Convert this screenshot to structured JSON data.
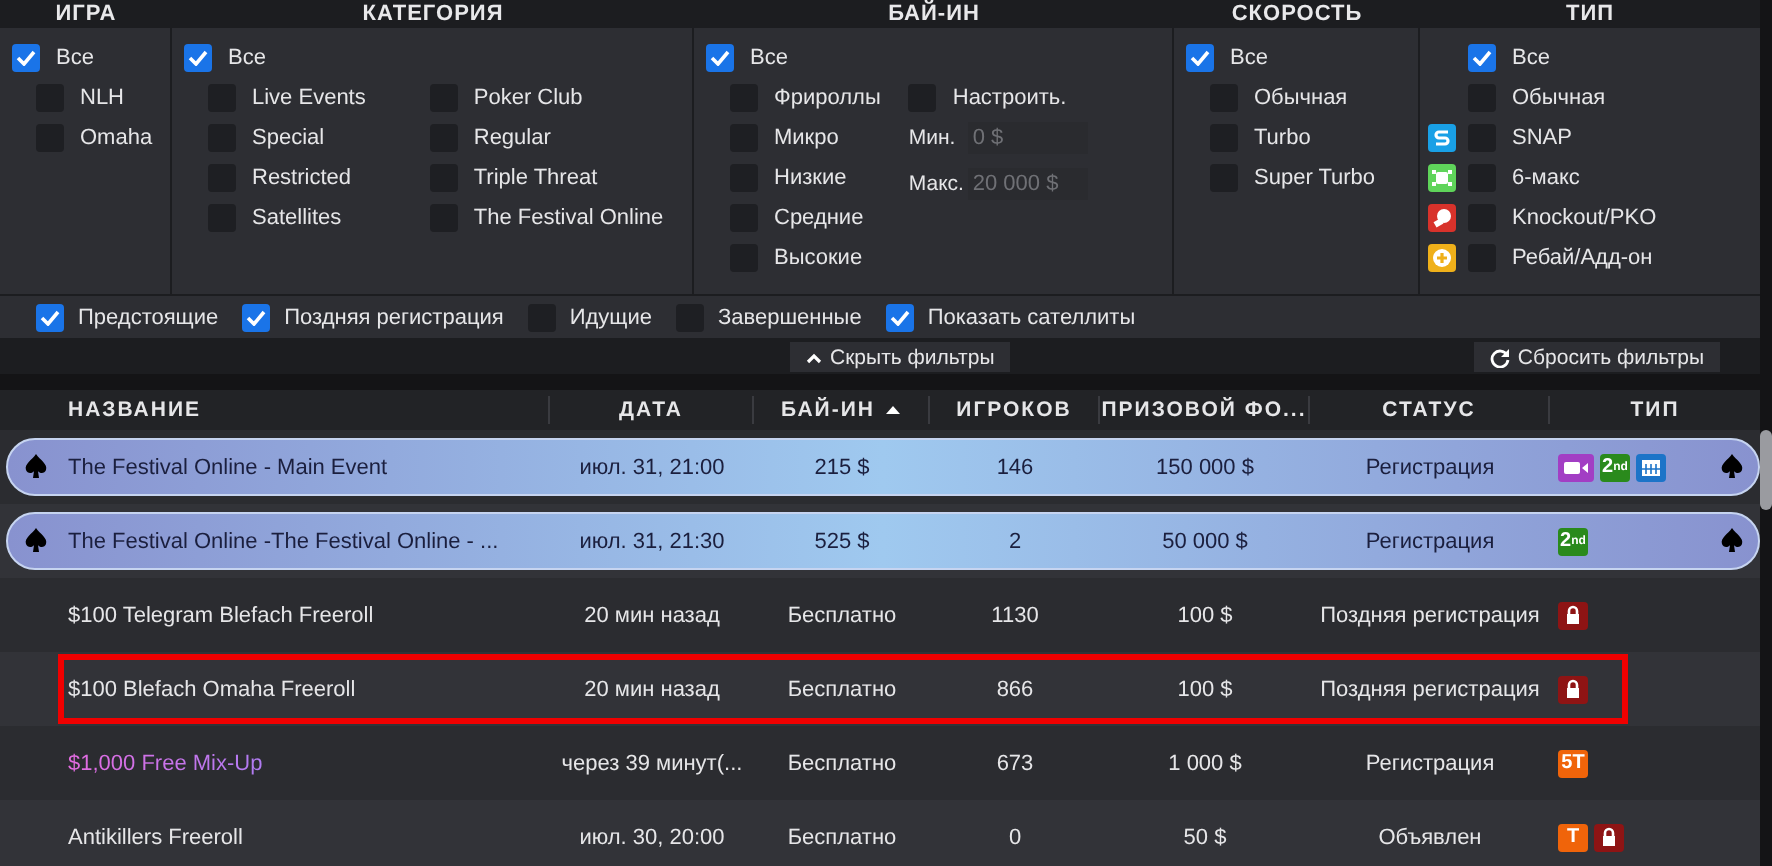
{
  "filters": {
    "sections": [
      {
        "title": "ИГРА",
        "all": {
          "label": "Все",
          "checked": true
        },
        "columns": [
          [
            {
              "label": "NLH",
              "checked": false
            },
            {
              "label": "Omaha",
              "checked": false
            }
          ]
        ]
      },
      {
        "title": "КАТЕГОРИЯ",
        "all": {
          "label": "Все",
          "checked": true
        },
        "columns": [
          [
            {
              "label": "Live Events",
              "checked": false
            },
            {
              "label": "Special",
              "checked": false
            },
            {
              "label": "Restricted",
              "checked": false
            },
            {
              "label": "Satellites",
              "checked": false
            }
          ],
          [
            {
              "label": "Poker Club",
              "checked": false
            },
            {
              "label": "Regular",
              "checked": false
            },
            {
              "label": "Triple Threat",
              "checked": false
            },
            {
              "label": "The Festival Online",
              "checked": false
            }
          ]
        ]
      },
      {
        "title": "БАЙ-ИН",
        "all": {
          "label": "Все",
          "checked": true
        },
        "columns": [
          [
            {
              "label": "Фрироллы",
              "checked": false
            },
            {
              "label": "Микро",
              "checked": false
            },
            {
              "label": "Низкие",
              "checked": false
            },
            {
              "label": "Средние",
              "checked": false
            },
            {
              "label": "Высокие",
              "checked": false
            }
          ]
        ],
        "custom": {
          "label": "Настроить.",
          "checked": false
        },
        "min": {
          "label": "Мин.",
          "placeholder": "0 $"
        },
        "max": {
          "label": "Макс.",
          "placeholder": "20 000 $"
        }
      },
      {
        "title": "СКОРОСТЬ",
        "all": {
          "label": "Все",
          "checked": true
        },
        "columns": [
          [
            {
              "label": "Обычная",
              "checked": false
            },
            {
              "label": "Turbo",
              "checked": false
            },
            {
              "label": "Super Turbo",
              "checked": false
            }
          ]
        ]
      },
      {
        "title": "ТИП",
        "all": {
          "label": "Все",
          "checked": true
        },
        "columns": [
          [
            {
              "label": "Обычная",
              "checked": false,
              "kind": "plain"
            },
            {
              "label": "SNAP",
              "checked": false,
              "kind": "snap"
            },
            {
              "label": "6-макс",
              "checked": false,
              "kind": "sixmax"
            },
            {
              "label": "Knockout/PKO",
              "checked": false,
              "kind": "knockout"
            },
            {
              "label": "Ребай/Адд-он",
              "checked": false,
              "kind": "rebuy"
            }
          ]
        ]
      }
    ],
    "options": [
      {
        "label": "Предстоящие",
        "checked": true
      },
      {
        "label": "Поздняя регистрация",
        "checked": true
      },
      {
        "label": "Идущие",
        "checked": false
      },
      {
        "label": "Завершенные",
        "checked": false
      },
      {
        "label": "Показать сателлиты",
        "checked": true
      }
    ],
    "hide_button": "Скрыть фильтры",
    "reset_button": "Сбросить фильтры"
  },
  "table": {
    "columns": [
      {
        "label": "НАЗВАНИЕ",
        "sorted": false
      },
      {
        "label": "ДАТА",
        "sorted": false
      },
      {
        "label": "БАЙ-ИН",
        "sorted": true
      },
      {
        "label": "ИГРОКОВ",
        "sorted": false
      },
      {
        "label": "ПРИЗОВОЙ ФО...",
        "sorted": false
      },
      {
        "label": "СТАТУС",
        "sorted": false
      },
      {
        "label": "ТИП",
        "sorted": false
      }
    ],
    "rows": [
      {
        "kind": "featured",
        "selected": false,
        "cells": [
          "The Festival Online - Main Event",
          "июл. 31, 21:00",
          "215 $",
          "146",
          "150 000 $",
          "Регистрация"
        ],
        "badges": [
          {
            "kind": "video"
          },
          {
            "kind": "second",
            "label": "2$^{nd}$"
          },
          {
            "kind": "calendar"
          }
        ]
      },
      {
        "kind": "featured",
        "selected": false,
        "cells": [
          "The Festival Online -The Festival Online - ...",
          "июл. 31, 21:30",
          "525 $",
          "2",
          "50 000 $",
          "Регистрация"
        ],
        "badges": [
          {
            "kind": "second",
            "label": "2$^{nd}$"
          }
        ]
      },
      {
        "kind": "normal",
        "selected": false,
        "cells": [
          "$100 Telegram Blefach Freeroll",
          "20 мин назад",
          "Бесплатно",
          "1130",
          "100 $",
          "Поздняя регистрация"
        ],
        "badges": [
          {
            "kind": "lock"
          }
        ]
      },
      {
        "kind": "normal",
        "selected": true,
        "cells": [
          "$100 Blefach Omaha Freeroll",
          "20 мин назад",
          "Бесплатно",
          "866",
          "100 $",
          "Поздняя регистрация"
        ],
        "badges": [
          {
            "kind": "lock"
          }
        ]
      },
      {
        "kind": "promo",
        "selected": false,
        "cells": [
          "$1,000 Free Mix-Up",
          "через 39 минут(...",
          "Бесплатно",
          "673",
          "1 000 $",
          "Регистрация"
        ],
        "badges": [
          {
            "kind": "text",
            "label": "5T"
          }
        ]
      },
      {
        "kind": "normal",
        "selected": false,
        "cells": [
          "Antikillers Freeroll",
          "июл. 30, 20:00",
          "Бесплатно",
          "0",
          "50 $",
          "Объявлен"
        ],
        "badges": [
          {
            "kind": "text",
            "label": "T"
          },
          {
            "kind": "lock"
          }
        ]
      }
    ]
  }
}
